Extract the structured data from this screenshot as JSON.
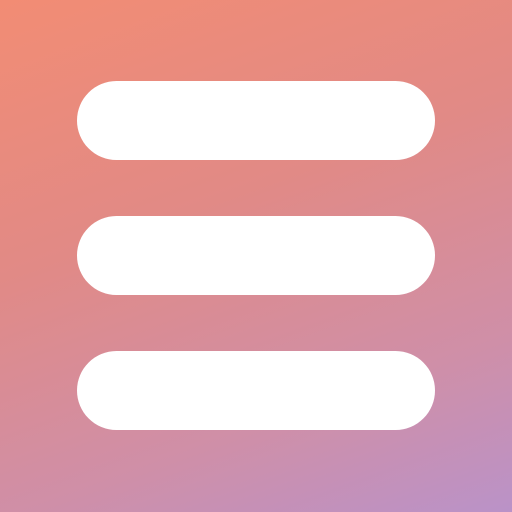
{
  "icon": {
    "name": "hamburger-menu-icon",
    "bar_count": 3
  },
  "colors": {
    "gradient_start": "#F28C74",
    "gradient_end": "#BA92C8",
    "bar": "#FFFFFF"
  }
}
